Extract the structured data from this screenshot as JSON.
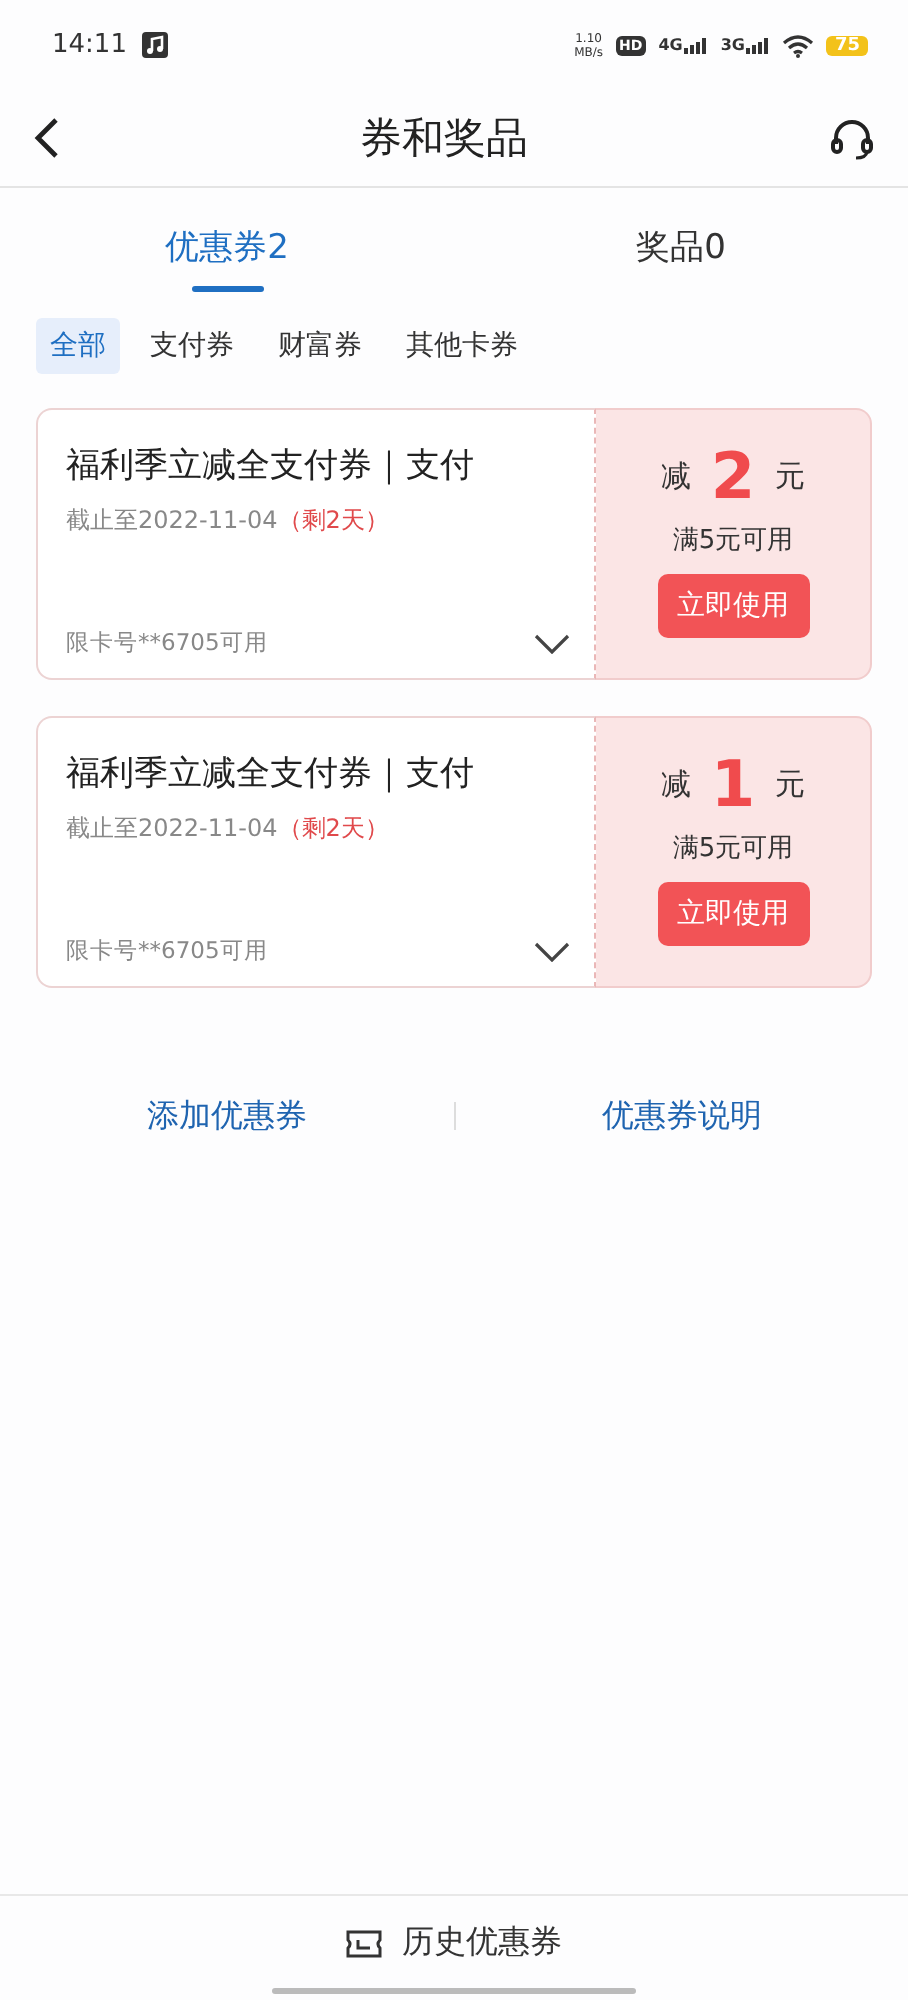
{
  "status_bar": {
    "time": "14:11",
    "speed_value": "1.10",
    "speed_unit": "MB/s",
    "hd": "HD",
    "signal_1": "4G",
    "signal_2": "3G",
    "battery": "75"
  },
  "header": {
    "title": "券和奖品"
  },
  "tabs": [
    {
      "label": "优惠券2",
      "selected": true
    },
    {
      "label": "奖品0",
      "selected": false
    }
  ],
  "filters": [
    {
      "label": "全部",
      "selected": true
    },
    {
      "label": "支付券",
      "selected": false
    },
    {
      "label": "财富券",
      "selected": false
    },
    {
      "label": "其他卡券",
      "selected": false
    }
  ],
  "coupons": [
    {
      "title": "福利季立减全支付券｜支付",
      "expiry": "截止至2022-11-04",
      "remaining": "（剩2天）",
      "card_limit": "限卡号**6705可用",
      "discount_prefix": "减",
      "amount": "2",
      "unit": "元",
      "condition": "满5元可用",
      "button": "立即使用"
    },
    {
      "title": "福利季立减全支付券｜支付",
      "expiry": "截止至2022-11-04",
      "remaining": "（剩2天）",
      "card_limit": "限卡号**6705可用",
      "discount_prefix": "减",
      "amount": "1",
      "unit": "元",
      "condition": "满5元可用",
      "button": "立即使用"
    }
  ],
  "links": [
    "添加优惠券",
    "优惠券说明"
  ],
  "bottom_bar": {
    "label": "历史优惠券"
  }
}
